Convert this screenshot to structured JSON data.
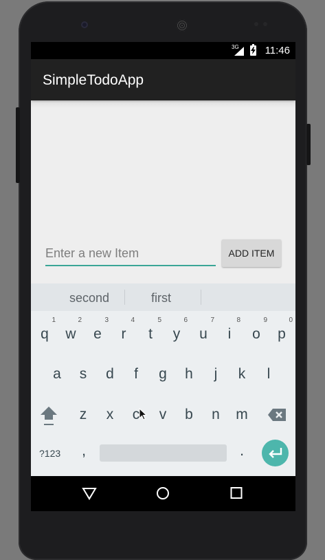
{
  "status_bar": {
    "network": "3G",
    "time": "11:46"
  },
  "app": {
    "title": "SimpleTodoApp"
  },
  "input": {
    "placeholder": "Enter a new Item",
    "value": ""
  },
  "add_button": {
    "label": "ADD ITEM"
  },
  "suggestions": [
    "second",
    "first"
  ],
  "keyboard": {
    "row1": [
      {
        "key": "q",
        "hint": "1"
      },
      {
        "key": "w",
        "hint": "2"
      },
      {
        "key": "e",
        "hint": "3"
      },
      {
        "key": "r",
        "hint": "4"
      },
      {
        "key": "t",
        "hint": "5"
      },
      {
        "key": "y",
        "hint": "6"
      },
      {
        "key": "u",
        "hint": "7"
      },
      {
        "key": "i",
        "hint": "8"
      },
      {
        "key": "o",
        "hint": "9"
      },
      {
        "key": "p",
        "hint": "0"
      }
    ],
    "row2": [
      "a",
      "s",
      "d",
      "f",
      "g",
      "h",
      "j",
      "k",
      "l"
    ],
    "row3": [
      "z",
      "x",
      "c",
      "v",
      "b",
      "n",
      "m"
    ],
    "symbols_label": "?123",
    "comma": ",",
    "period": ".",
    "icons": {
      "shift": "shift-icon",
      "backspace": "backspace-icon",
      "enter": "enter-icon"
    }
  },
  "nav_bar": {
    "icons": [
      "back-icon",
      "home-icon",
      "recents-icon"
    ]
  },
  "colors": {
    "accent": "#3aa596",
    "action_bar": "#212121",
    "enter_key": "#4db6ac"
  }
}
